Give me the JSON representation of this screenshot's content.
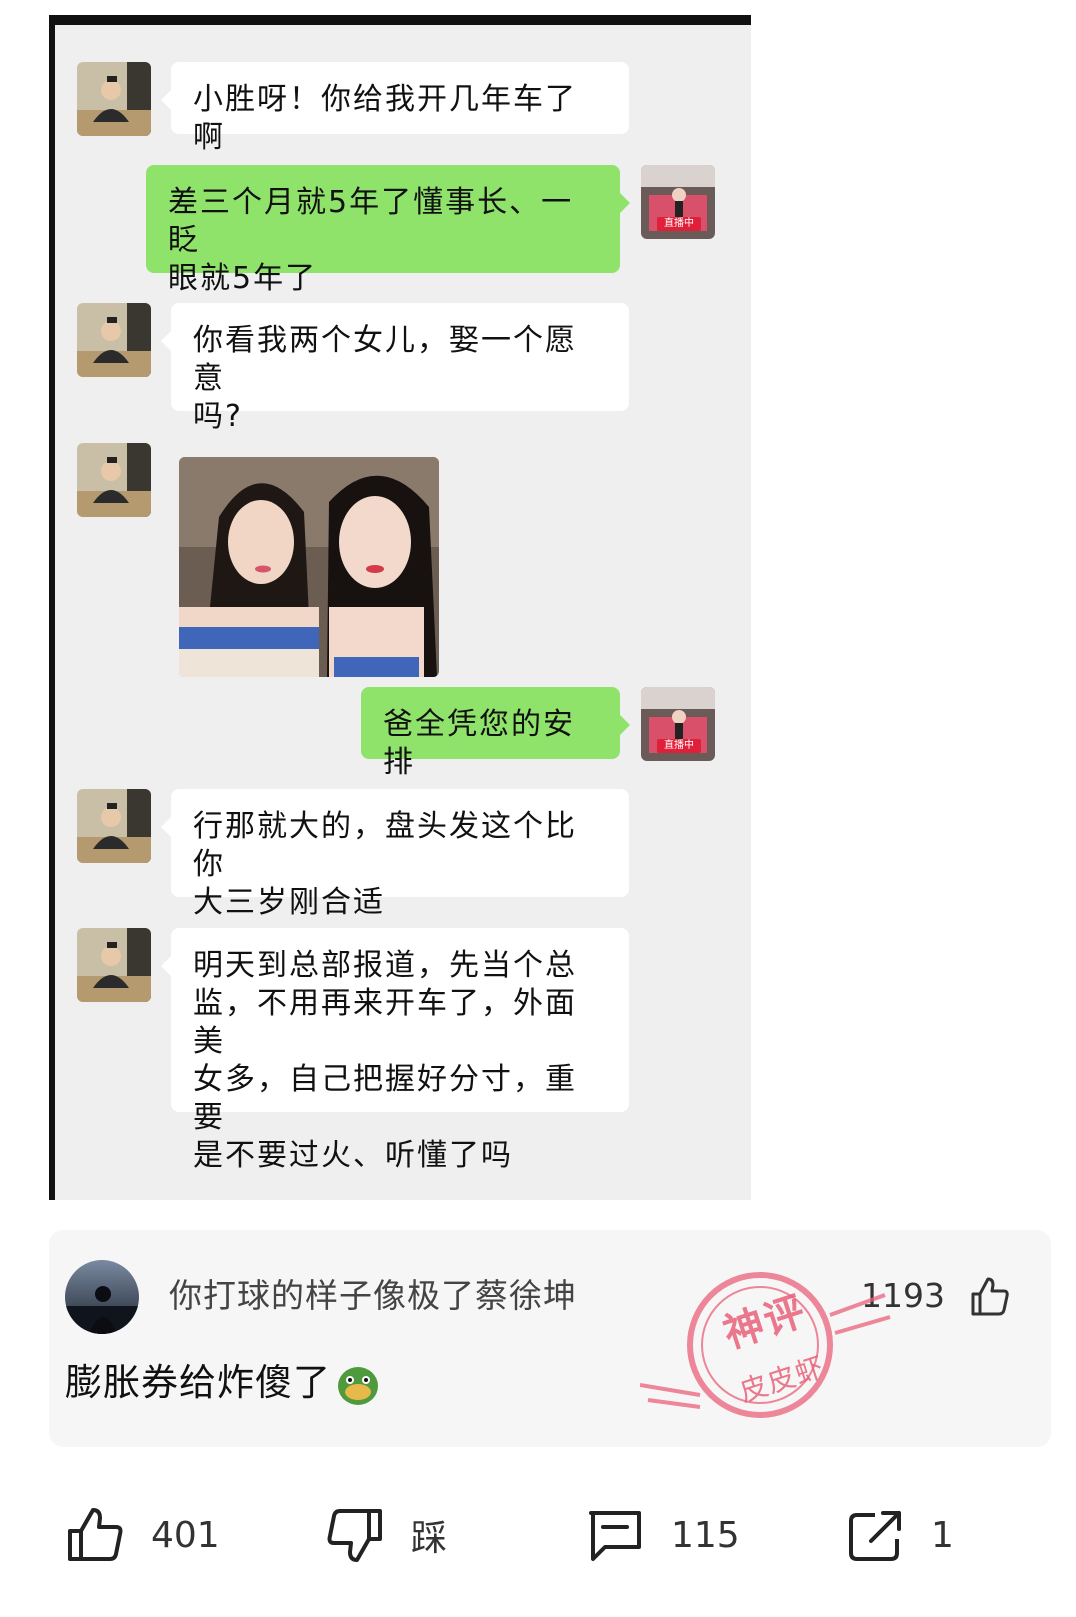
{
  "chat": {
    "messages": [
      {
        "side": "in",
        "text": "小胜呀！你给我开几年车了啊"
      },
      {
        "side": "out",
        "line1": "差三个月就5年了懂事长、一眨",
        "line2": "眼就5年了"
      },
      {
        "side": "in",
        "line1": "你看我两个女儿，娶一个愿意",
        "line2": "吗?"
      },
      {
        "side": "in",
        "type": "image"
      },
      {
        "side": "out",
        "text": "爸全凭您的安排"
      },
      {
        "side": "in",
        "line1": "行那就大的，盘头发这个比你",
        "line2": "大三岁刚合适"
      },
      {
        "side": "in",
        "line1": "明天到总部报道，先当个总",
        "line2": "监，不用再来开车了，外面美",
        "line3": "女多，自己把握好分寸，重要",
        "line4": "是不要过火、听懂了吗"
      }
    ],
    "live_tag": "直播中"
  },
  "comment": {
    "username": "你打球的样子像极了蔡徐坤",
    "like_count": "1193",
    "text": "膨胀券给炸傻了",
    "emoji": "duck-emoji"
  },
  "watermark": {
    "top": "神评",
    "bottom": "皮皮虾"
  },
  "actions": {
    "like": "401",
    "dislike": "踩",
    "comments": "115",
    "share": "1"
  },
  "colors": {
    "outgoing_bubble": "#8fe36a",
    "incoming_bubble": "#ffffff",
    "chat_background": "#efefef",
    "stamp": "#e86078"
  }
}
